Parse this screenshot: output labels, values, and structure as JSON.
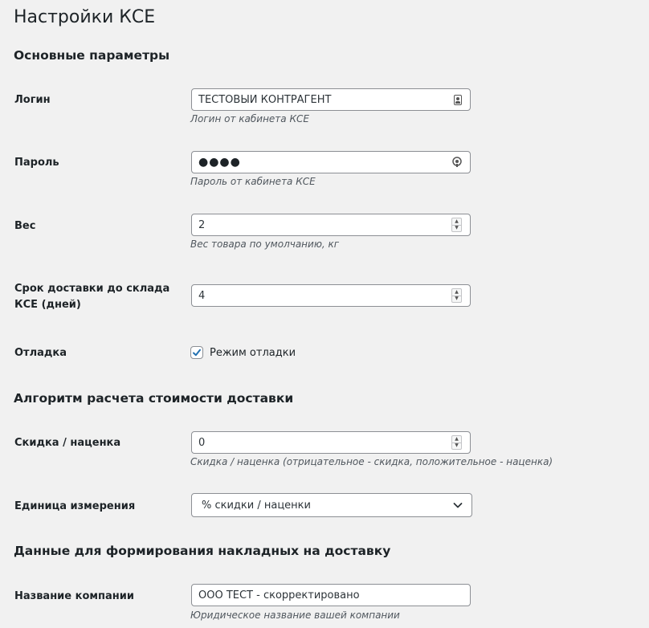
{
  "page": {
    "title": "Настройки КСЕ"
  },
  "sections": {
    "main": "Основные параметры",
    "algorithm": "Алгоритм расчета стоимости доставки",
    "waybill": "Данные для формирования накладных на доставку"
  },
  "fields": {
    "login": {
      "label": "Логин",
      "value": "ТЕСТОВЫЙ КОНТРАГЕНТ",
      "description": "Логин от кабинета КСЕ"
    },
    "password": {
      "label": "Пароль",
      "value": "●●●●",
      "description": "Пароль от кабинета КСЕ"
    },
    "weight": {
      "label": "Вес",
      "value": "2",
      "description": "Вес товара по умолчанию, кг"
    },
    "delivery_days": {
      "label": "Срок доставки до склада КСЕ (дней)",
      "value": "4"
    },
    "debug": {
      "label": "Отладка",
      "checkbox_label": "Режим отладки",
      "checked": true
    },
    "discount": {
      "label": "Скидка / наценка",
      "value": "0",
      "description": "Скидка / наценка (отрицательное - скидка, положительное - наценка)"
    },
    "unit": {
      "label": "Единица измерения",
      "selected": "% скидки / наценки"
    },
    "company": {
      "label": "Название компании",
      "value": "ООО ТЕСТ - скорректировано",
      "description": "Юридическое название вашей компании"
    }
  },
  "colors": {
    "background": "#f1f1f1",
    "accent": "#2271b1",
    "input_border": "#8c8f94"
  },
  "icons": {
    "login_field": "id-card-icon",
    "password_field": "key-icon",
    "number_spinner": "spinner-arrows-icon",
    "select": "chevron-down-icon",
    "checkbox": "checkmark-icon"
  }
}
